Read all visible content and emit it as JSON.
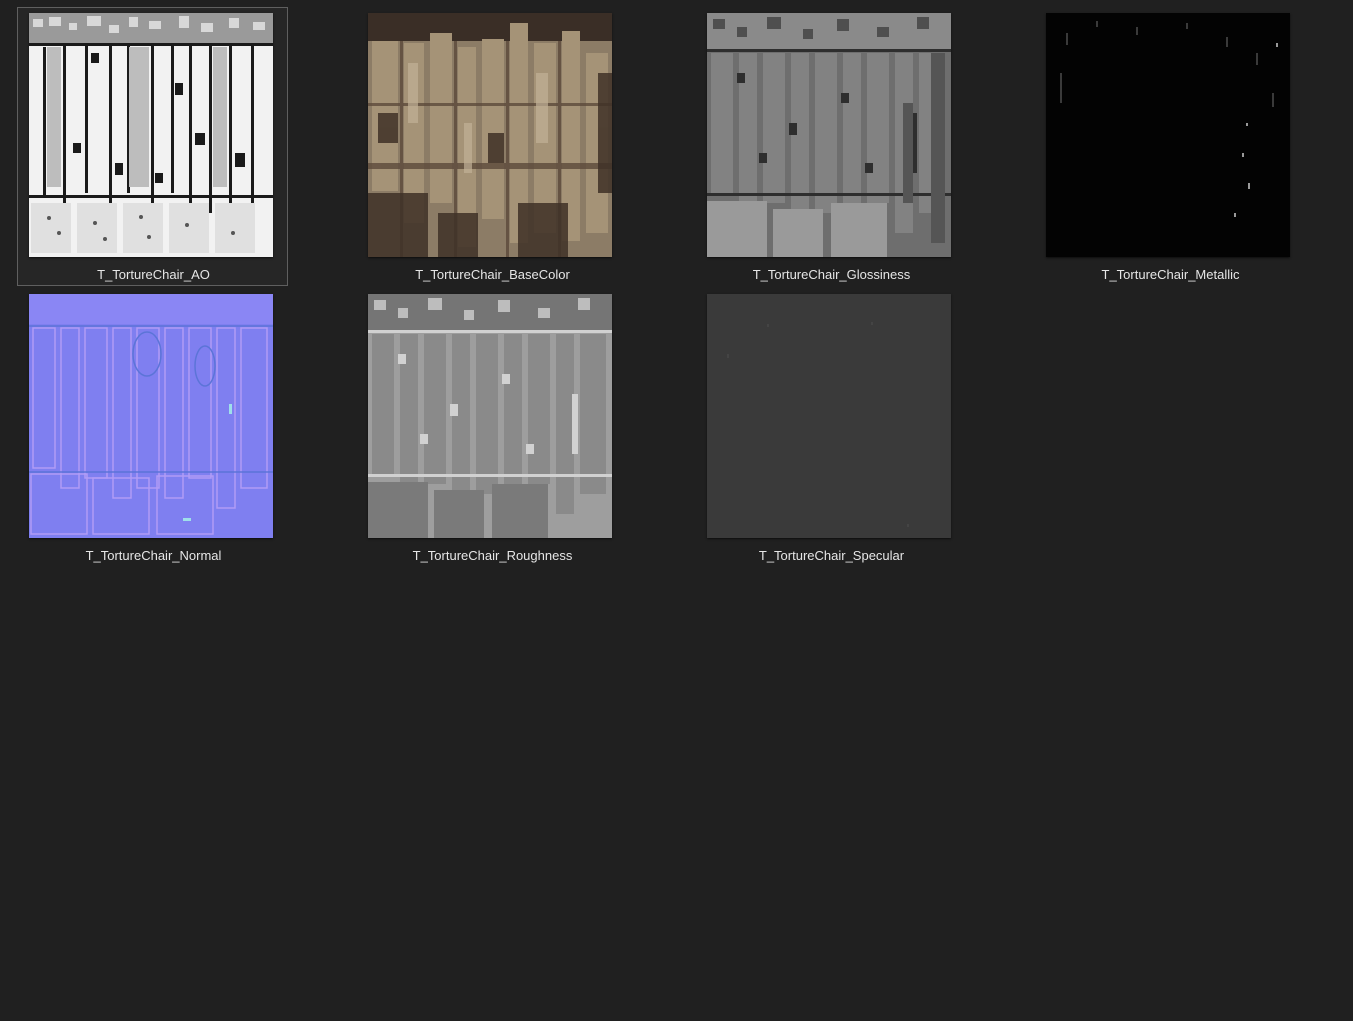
{
  "files": [
    {
      "name": "T_TortureChair_AO",
      "selected": true,
      "preview": "ao"
    },
    {
      "name": "T_TortureChair_BaseColor",
      "selected": false,
      "preview": "basecolor"
    },
    {
      "name": "T_TortureChair_Glossiness",
      "selected": false,
      "preview": "glossiness"
    },
    {
      "name": "T_TortureChair_Metallic",
      "selected": false,
      "preview": "metallic"
    },
    {
      "name": "T_TortureChair_Normal",
      "selected": false,
      "preview": "normal"
    },
    {
      "name": "T_TortureChair_Roughness",
      "selected": false,
      "preview": "roughness"
    },
    {
      "name": "T_TortureChair_Specular",
      "selected": false,
      "preview": "specular"
    }
  ],
  "colors": {
    "background": "#202020",
    "selection_border": "#5f5f5f",
    "label_text": "#e6e6e6"
  }
}
